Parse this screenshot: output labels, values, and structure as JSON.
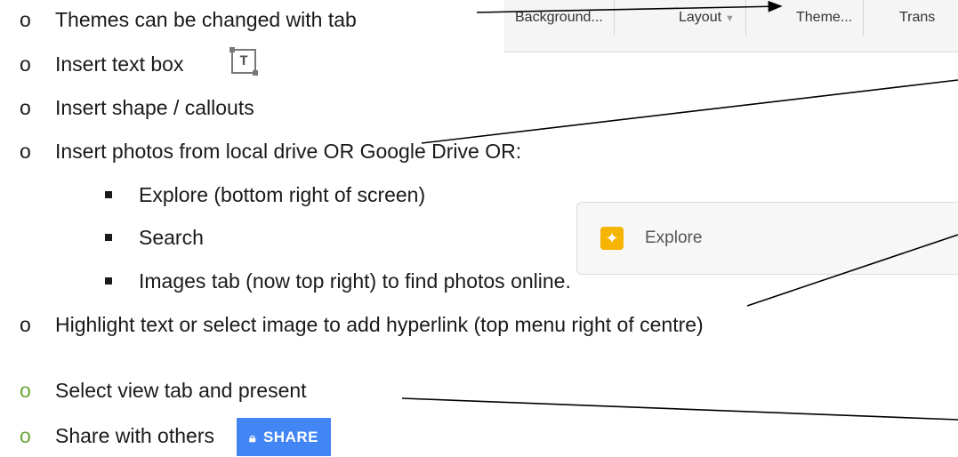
{
  "bullets": {
    "themes": "Themes can be changed with tab",
    "textbox": "Insert text box",
    "shapes": "Insert shape / callouts",
    "photos": "Insert photos from local drive OR Google Drive OR:",
    "explore": "Explore (bottom right of screen)",
    "search": "Search",
    "images": "Images tab (now top right) to find photos online.",
    "hyperlink": "Highlight text or select image to add hyperlink (top menu right of centre)",
    "view": "Select view tab and present",
    "share": "Share with others"
  },
  "toolbar": {
    "background": "Background...",
    "layout": "Layout",
    "theme": "Theme...",
    "transition": "Trans"
  },
  "textbox_icon_glyph": "T",
  "explore_label": "Explore",
  "share_label": "SHARE",
  "bullet_symbol": "o",
  "colors": {
    "share_blue": "#4285f4",
    "explore_yellow": "#f4b400",
    "bullet_green": "#6ba539"
  }
}
